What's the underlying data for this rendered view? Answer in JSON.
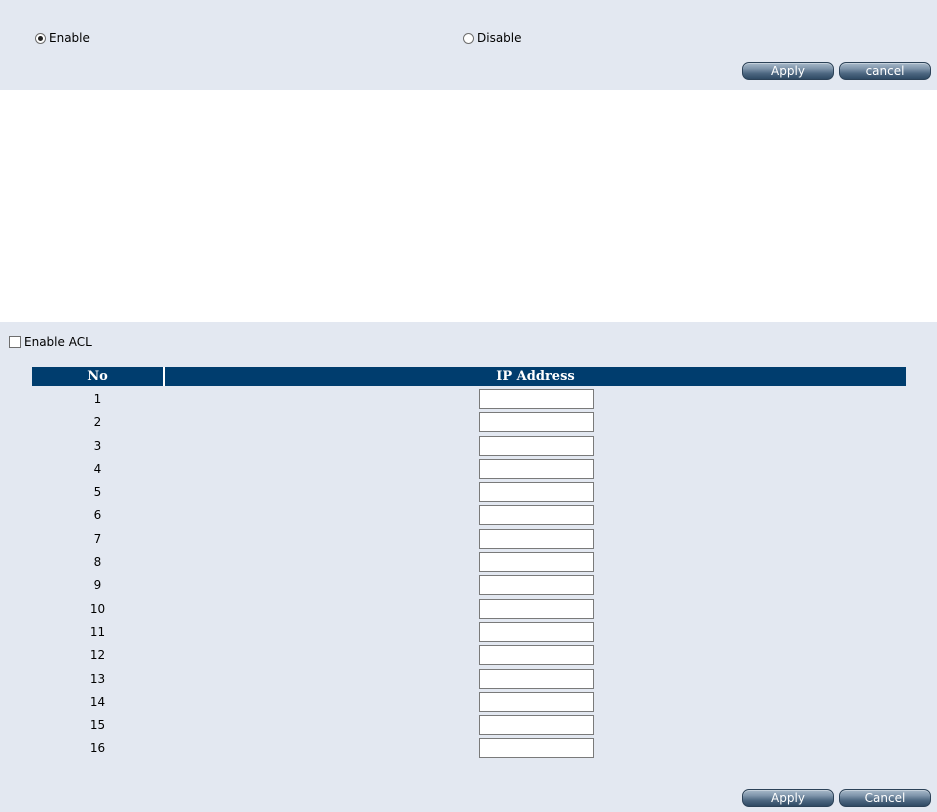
{
  "mode": {
    "enable_label": "Enable",
    "disable_label": "Disable",
    "selected": "Enable"
  },
  "top_buttons": {
    "apply_label": "Apply",
    "cancel_label": "cancel"
  },
  "acl": {
    "checkbox_label": "Enable ACL",
    "checked": false
  },
  "table": {
    "headers": {
      "no": "No",
      "ip": "IP Address"
    },
    "rows": [
      {
        "no": "1",
        "ip": ""
      },
      {
        "no": "2",
        "ip": ""
      },
      {
        "no": "3",
        "ip": ""
      },
      {
        "no": "4",
        "ip": ""
      },
      {
        "no": "5",
        "ip": ""
      },
      {
        "no": "6",
        "ip": ""
      },
      {
        "no": "7",
        "ip": ""
      },
      {
        "no": "8",
        "ip": ""
      },
      {
        "no": "9",
        "ip": ""
      },
      {
        "no": "10",
        "ip": ""
      },
      {
        "no": "11",
        "ip": ""
      },
      {
        "no": "12",
        "ip": ""
      },
      {
        "no": "13",
        "ip": ""
      },
      {
        "no": "14",
        "ip": ""
      },
      {
        "no": "15",
        "ip": ""
      },
      {
        "no": "16",
        "ip": ""
      }
    ]
  },
  "bottom_buttons": {
    "apply_label": "Apply",
    "cancel_label": "Cancel"
  }
}
